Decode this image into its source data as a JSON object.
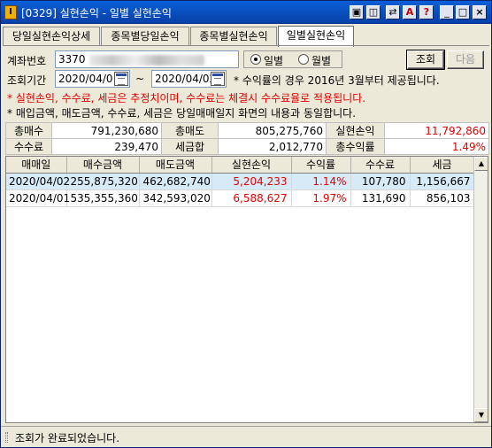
{
  "window": {
    "title": "[0329] 실현손익 - 일별 실현손익",
    "icon_letter": "I",
    "icon": "app-icon"
  },
  "titlebar_buttons": [
    {
      "name": "window-layout-icon",
      "glyph": "▣"
    },
    {
      "name": "window-restore-icon",
      "glyph": "◫"
    },
    {
      "name": "link-icon",
      "glyph": "⇄"
    },
    {
      "name": "font-a-icon",
      "glyph": "A"
    },
    {
      "name": "help-icon",
      "glyph": "?"
    },
    {
      "name": "minimize-icon",
      "glyph": "_"
    },
    {
      "name": "maximize-icon",
      "glyph": "□"
    },
    {
      "name": "close-icon",
      "glyph": "×"
    }
  ],
  "tabs": [
    {
      "label": "당일실현손익상세",
      "active": false
    },
    {
      "label": "종목별당일손익",
      "active": false
    },
    {
      "label": "종목별실현손익",
      "active": false
    },
    {
      "label": "일별실현손익",
      "active": true
    }
  ],
  "search": {
    "account_label": "계좌번호",
    "account_value": "3370",
    "period_label": "조회기간",
    "start_date": "2020/04/01",
    "separator": "~",
    "end_date": "2020/04/02",
    "period_note": "* 수익률의 경우 2016년 3월부터 제공됩니다.",
    "radio_daily": "일별",
    "radio_monthly": "월별",
    "radio_selected": "daily",
    "query_button": "조회",
    "next_button": "다음"
  },
  "notices": {
    "red": "* 실현손익, 수수료, 세금은 추정치이며, 수수료는 체결시 수수료율로 적용됩니다.",
    "black": "* 매입금액, 매도금액, 수수료, 세금은 당일매매일지 화면의 내용과 동일합니다."
  },
  "summary": {
    "total_buy_label": "총매수",
    "total_buy": "791,230,680",
    "total_sell_label": "총매도",
    "total_sell": "805,275,760",
    "realized_pl_label": "실현손익",
    "realized_pl": "11,792,860",
    "fee_label": "수수료",
    "fee": "239,470",
    "tax_label": "세금합",
    "tax": "2,012,770",
    "total_return_label": "총수익률",
    "total_return": "1.49%"
  },
  "table": {
    "columns": [
      "매매일",
      "매수금액",
      "매도금액",
      "실현손익",
      "수익률",
      "수수료",
      "세금"
    ],
    "rows": [
      [
        "2020/04/02",
        "255,875,320",
        "462,682,740",
        "5,204,233",
        "1.14%",
        "107,780",
        "1,156,667"
      ],
      [
        "2020/04/01",
        "535,355,360",
        "342,593,020",
        "6,588,627",
        "1.97%",
        "131,690",
        "856,103"
      ]
    ]
  },
  "status": {
    "message": "조회가 완료되었습니다."
  },
  "colors": {
    "profit": "#e00000",
    "selected_row": "#d6eaf8",
    "title_bar": "#0a5fd8"
  }
}
